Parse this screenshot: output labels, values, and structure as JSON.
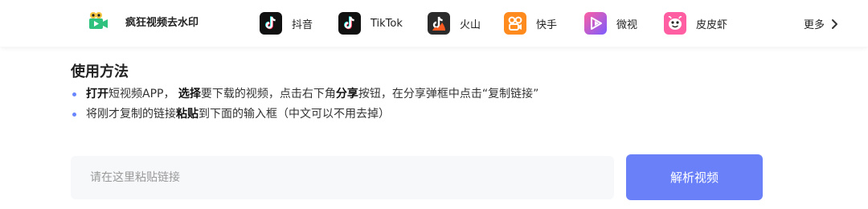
{
  "header": {
    "brand": {
      "name": "疯狂视频去水印",
      "icon": "video-camera-icon"
    },
    "nav": [
      {
        "label": "抖音",
        "icon": "douyin-icon",
        "color": "#111111"
      },
      {
        "label": "TikTok",
        "icon": "tiktok-icon",
        "color": "#111111"
      },
      {
        "label": "火山",
        "icon": "huoshan-icon",
        "color": "#2b2b2b"
      },
      {
        "label": "快手",
        "icon": "kuaishou-icon",
        "color": "#ff8a1e"
      },
      {
        "label": "微视",
        "icon": "weishi-icon",
        "color": "#8b5cf6"
      },
      {
        "label": "皮皮虾",
        "icon": "pipixia-icon",
        "color": "#f472b6"
      }
    ],
    "more_label": "更多"
  },
  "instructions": {
    "title": "使用方法",
    "step1": {
      "p1": "打开",
      "p2": "短视频APP， ",
      "p3": "选择",
      "p4": "要下载的视频，点击右下角",
      "p5": "分享",
      "p6": "按钮，在分享弹框中点击“复制链接”"
    },
    "step2": {
      "p1": "将刚才复制的链接",
      "p2": "粘贴",
      "p3": "到下面的输入框（中文可以不用去掉）"
    }
  },
  "form": {
    "placeholder": "请在这里粘贴链接",
    "value": "",
    "submit_label": "解析视频"
  },
  "colors": {
    "accent": "#6a80f8",
    "bullet": "#6a86ff"
  }
}
